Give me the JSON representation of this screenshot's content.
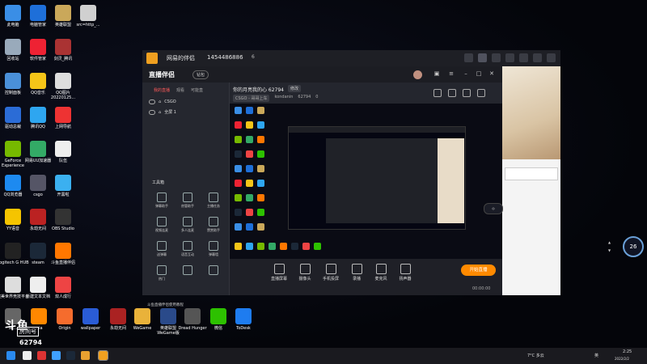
{
  "desktop_icons": [
    {
      "label": "此电脑",
      "icon": "computer-icon",
      "color": "#3a8ee6",
      "col": 0,
      "row": 0
    },
    {
      "label": "电脑管家",
      "icon": "shield-icon",
      "color": "#1e6fd9",
      "col": 1,
      "row": 0
    },
    {
      "label": "英雄联盟",
      "icon": "lol-icon",
      "color": "#caa85a",
      "col": 2,
      "row": 0
    },
    {
      "label": "src=http_...",
      "icon": "file-icon",
      "color": "#d0d0d0",
      "col": 3,
      "row": 0
    },
    {
      "label": "回收站",
      "icon": "recycle-bin-icon",
      "color": "#9ab",
      "col": 0,
      "row": 1
    },
    {
      "label": "软件管家",
      "icon": "app-store-icon",
      "color": "#e23",
      "col": 1,
      "row": 1
    },
    {
      "label": "剑灵_腾讯",
      "icon": "game-icon",
      "color": "#a33",
      "col": 2,
      "row": 1
    },
    {
      "label": "控制面板",
      "icon": "control-panel-icon",
      "color": "#4a90d9",
      "col": 0,
      "row": 2
    },
    {
      "label": "QQ音乐",
      "icon": "music-icon",
      "color": "#f5c518",
      "col": 1,
      "row": 2
    },
    {
      "label": "QQ图片20220125...",
      "icon": "image-icon",
      "color": "#ddd",
      "col": 2,
      "row": 2
    },
    {
      "label": "驱动总裁",
      "icon": "driver-icon",
      "color": "#2b6cd6",
      "col": 0,
      "row": 3
    },
    {
      "label": "腾讯QQ",
      "icon": "qq-icon",
      "color": "#2ea6f0",
      "col": 1,
      "row": 3
    },
    {
      "label": "上网导航",
      "icon": "browser-icon",
      "color": "#e33",
      "col": 2,
      "row": 3
    },
    {
      "label": "GeForce Experience",
      "icon": "nvidia-icon",
      "color": "#76b900",
      "col": 0,
      "row": 4
    },
    {
      "label": "网易UU加速器",
      "icon": "uu-icon",
      "color": "#3a6",
      "col": 1,
      "row": 4
    },
    {
      "label": "队伍",
      "icon": "file-icon",
      "color": "#eee",
      "col": 2,
      "row": 4
    },
    {
      "label": "QQ浏览器",
      "icon": "qq-browser-icon",
      "color": "#1d8af0",
      "col": 0,
      "row": 5
    },
    {
      "label": "csgo",
      "icon": "csgo-icon",
      "color": "#556",
      "col": 1,
      "row": 5
    },
    {
      "label": "开黑啦",
      "icon": "kaiheila-icon",
      "color": "#3bb0f0",
      "col": 2,
      "row": 5
    },
    {
      "label": "YY语音",
      "icon": "yy-icon",
      "color": "#f5c400",
      "col": 0,
      "row": 6
    },
    {
      "label": "永劫无间",
      "icon": "game-icon",
      "color": "#b22",
      "col": 1,
      "row": 6
    },
    {
      "label": "OBS Studio",
      "icon": "obs-icon",
      "color": "#333",
      "col": 2,
      "row": 6
    },
    {
      "label": "Logitech G HUB",
      "icon": "logitech-icon",
      "color": "#222",
      "col": 0,
      "row": 7
    },
    {
      "label": "steam",
      "icon": "steam-icon",
      "color": "#1b2838",
      "col": 1,
      "row": 7
    },
    {
      "label": "斗鱼直播伴侣",
      "icon": "douyu-icon",
      "color": "#f70",
      "col": 2,
      "row": 7
    },
    {
      "label": "完美世界竞技平台",
      "icon": "perfect-world-icon",
      "color": "#ddd",
      "col": 0,
      "row": 8
    },
    {
      "label": "新建文本文档",
      "icon": "text-file-icon",
      "color": "#eee",
      "col": 1,
      "row": 8
    },
    {
      "label": "双人成行",
      "icon": "game-icon",
      "color": "#e44",
      "col": 2,
      "row": 8
    }
  ],
  "bottom_icons": [
    {
      "label": "SE...",
      "icon": "game-icon",
      "color": "#666"
    },
    {
      "label": "...ia",
      "icon": "vlc-icon",
      "color": "#f80"
    },
    {
      "label": "Origin",
      "icon": "origin-icon",
      "color": "#f56c2d"
    },
    {
      "label": "wallpaper",
      "icon": "wallpaper-icon",
      "color": "#2a5cd6"
    },
    {
      "label": "永劫无间",
      "icon": "game-icon",
      "color": "#a22"
    },
    {
      "label": "WeGame",
      "icon": "wegame-icon",
      "color": "#e9b23a"
    },
    {
      "label": "英雄联盟WeGame版",
      "icon": "lol-icon",
      "color": "#2a4a8a"
    },
    {
      "label": "Dread Hunger",
      "icon": "game-icon",
      "color": "#555"
    },
    {
      "label": "微信",
      "icon": "wechat-icon",
      "color": "#2dc100"
    },
    {
      "label": "ToDesk",
      "icon": "todesk-icon",
      "color": "#1e7cf0"
    }
  ],
  "host_bar": {
    "title": "网易的伴侣",
    "room": "1454486886",
    "uid": "6"
  },
  "app": {
    "brand": "直播伴侣",
    "brand_badge": "钻包",
    "sidebar_tabs": [
      "我的直播",
      "观看",
      "可能直"
    ],
    "scenes": [
      "CSGO",
      "全屏 1"
    ],
    "toolbox_title": "工具箱",
    "tools": [
      "弹幕助手",
      "房管助手",
      "主播任务",
      "视频连麦",
      "多人连麦",
      "赞赏助手",
      "送弹幕",
      "语音互动",
      "弹幕墙",
      "热门",
      "",
      ""
    ],
    "notice": "斗鱼直播伴侣使用教程",
    "room_title": "你的月亮我的心 62794",
    "edit_label": "修改",
    "category": "CSGO - 哥哥上车",
    "streamer": "kondanin",
    "streamer_id": "62794",
    "likes": "0",
    "bottom_controls": [
      "直播屏幕",
      "摄像头",
      "手机投屏",
      "录播",
      "麦克风",
      "扬声器"
    ],
    "live_button": "开始直播",
    "timer": "00:00:00"
  },
  "side_gadget": {
    "value": "26"
  },
  "watermark": {
    "big": "斗鱼",
    "sub": "房间号",
    "number": "62794"
  },
  "tray": {
    "temp": "7°C 多云",
    "lang": "英",
    "time": "2:25",
    "date": "2022/2/2"
  }
}
